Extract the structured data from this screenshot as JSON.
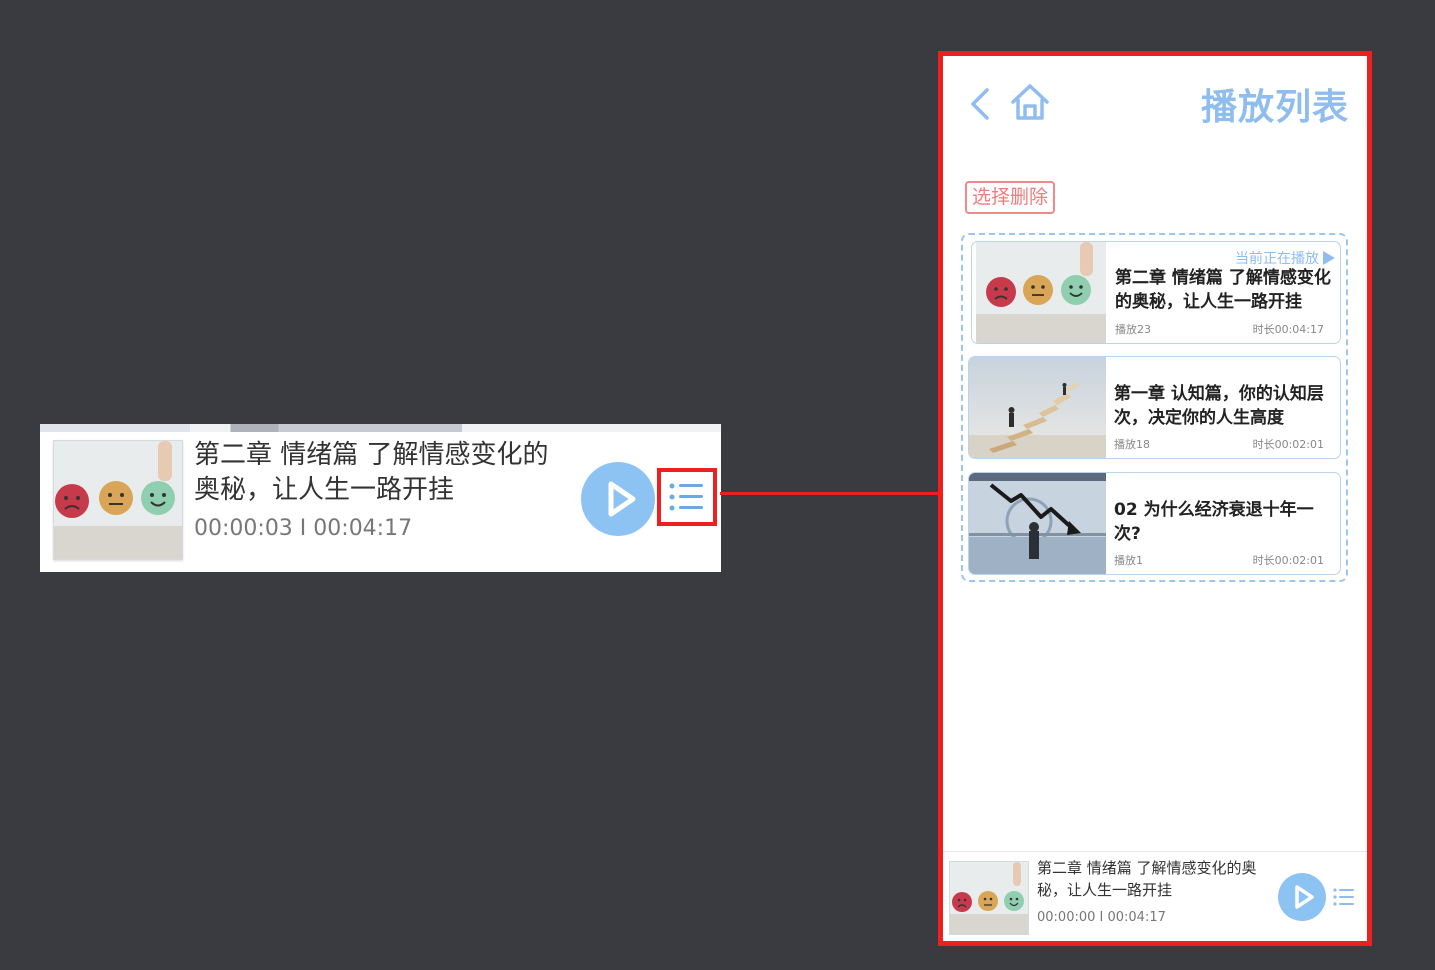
{
  "zoom": {
    "title": "第二章 情绪篇 了解情感变化的奥秘，让人生一路开挂",
    "time": "00:00:03 I 00:04:17"
  },
  "header": {
    "title": "播放列表"
  },
  "toolbar": {
    "delete_label": "选择删除"
  },
  "playlist": {
    "now_playing_label": "当前正在播放",
    "items": [
      {
        "title": "第二章 情绪篇 了解情感变化的奥秘，让人生一路开挂",
        "plays": "播放23",
        "duration": "时长00:04:17",
        "thumb": "emotion-faces"
      },
      {
        "title": "第一章 认知篇，你的认知层次，决定你的人生高度",
        "plays": "播放18",
        "duration": "时长00:02:01",
        "thumb": "stairs-climb"
      },
      {
        "title": "02 为什么经济衰退十年一次?",
        "plays": "播放1",
        "duration": "时长00:02:01",
        "thumb": "economy-decline"
      }
    ]
  },
  "player": {
    "title": "第二章 情绪篇 了解情感变化的奥秘，让人生一路开挂",
    "time": "00:00:00 I 00:04:17"
  },
  "colors": {
    "accent": "#8fbdf0",
    "highlight": "#ee1f1f",
    "background": "#393b40"
  }
}
